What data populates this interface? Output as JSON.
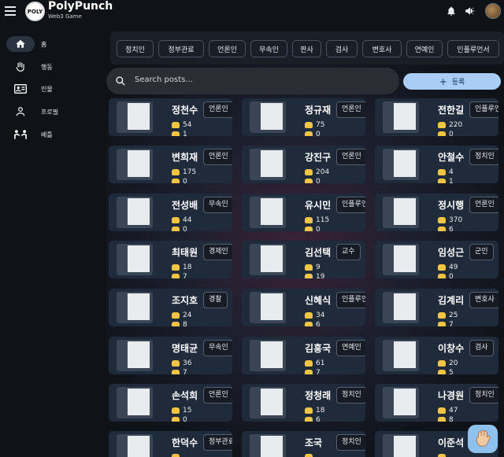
{
  "header": {
    "brand_title": "PolyPunch",
    "brand_subtitle": "Web3 Game",
    "logo_text": "POLY"
  },
  "sidebar": {
    "items": [
      {
        "label": "홈",
        "icon": "home-icon",
        "active": true
      },
      {
        "label": "행동",
        "icon": "hand-icon",
        "active": false
      },
      {
        "label": "인물",
        "icon": "id-card-icon",
        "active": false
      },
      {
        "label": "프로필",
        "icon": "person-icon",
        "active": false
      },
      {
        "label": "배틀",
        "icon": "battle-icon",
        "active": false
      }
    ]
  },
  "filters": [
    "정치인",
    "정부관료",
    "언론인",
    "무속인",
    "판사",
    "검사",
    "변호사",
    "연예인",
    "인플루언서"
  ],
  "search": {
    "placeholder": "Search posts..."
  },
  "register_label": "등록",
  "cards": [
    {
      "name": "정천수",
      "tag": "언론인",
      "count1": "54",
      "count2": "1"
    },
    {
      "name": "정규재",
      "tag": "언론인",
      "count1": "75",
      "count2": "0"
    },
    {
      "name": "전한길",
      "tag": "인플루언서",
      "count1": "220",
      "count2": "0"
    },
    {
      "name": "변희재",
      "tag": "언론인",
      "count1": "175",
      "count2": "0"
    },
    {
      "name": "강진구",
      "tag": "언론인",
      "count1": "204",
      "count2": "0"
    },
    {
      "name": "안철수",
      "tag": "정치인",
      "count1": "4",
      "count2": "1"
    },
    {
      "name": "전성배",
      "tag": "무속인",
      "count1": "44",
      "count2": "0"
    },
    {
      "name": "유시민",
      "tag": "인플루언서",
      "count1": "115",
      "count2": "0"
    },
    {
      "name": "정시행",
      "tag": "언론인",
      "count1": "370",
      "count2": "6"
    },
    {
      "name": "최태원",
      "tag": "경제인",
      "count1": "18",
      "count2": "7"
    },
    {
      "name": "김선택",
      "tag": "교수",
      "count1": "9",
      "count2": "19"
    },
    {
      "name": "임성근",
      "tag": "군인",
      "count1": "49",
      "count2": "0"
    },
    {
      "name": "조지호",
      "tag": "경찰",
      "count1": "24",
      "count2": "8"
    },
    {
      "name": "신혜식",
      "tag": "인플루언서",
      "count1": "34",
      "count2": "6"
    },
    {
      "name": "김계리",
      "tag": "변호사",
      "count1": "25",
      "count2": "7"
    },
    {
      "name": "명태균",
      "tag": "무속인",
      "count1": "36",
      "count2": "7"
    },
    {
      "name": "김흥국",
      "tag": "연예인",
      "count1": "61",
      "count2": "7"
    },
    {
      "name": "이창수",
      "tag": "검사",
      "count1": "20",
      "count2": "5"
    },
    {
      "name": "손석희",
      "tag": "언론인",
      "count1": "15",
      "count2": "0"
    },
    {
      "name": "정청래",
      "tag": "정치인",
      "count1": "18",
      "count2": "6"
    },
    {
      "name": "나경원",
      "tag": "정치인",
      "count1": "47",
      "count2": "8"
    },
    {
      "name": "한덕수",
      "tag": "정부관료",
      "count1": "",
      "count2": ""
    },
    {
      "name": "조국",
      "tag": "정치인",
      "count1": "",
      "count2": ""
    },
    {
      "name": "이준석",
      "tag": "",
      "count1": "",
      "count2": ""
    }
  ],
  "colors": {
    "accent": "#a9cdf4",
    "card": "#1f2a3b",
    "fist": "#f4c542"
  }
}
